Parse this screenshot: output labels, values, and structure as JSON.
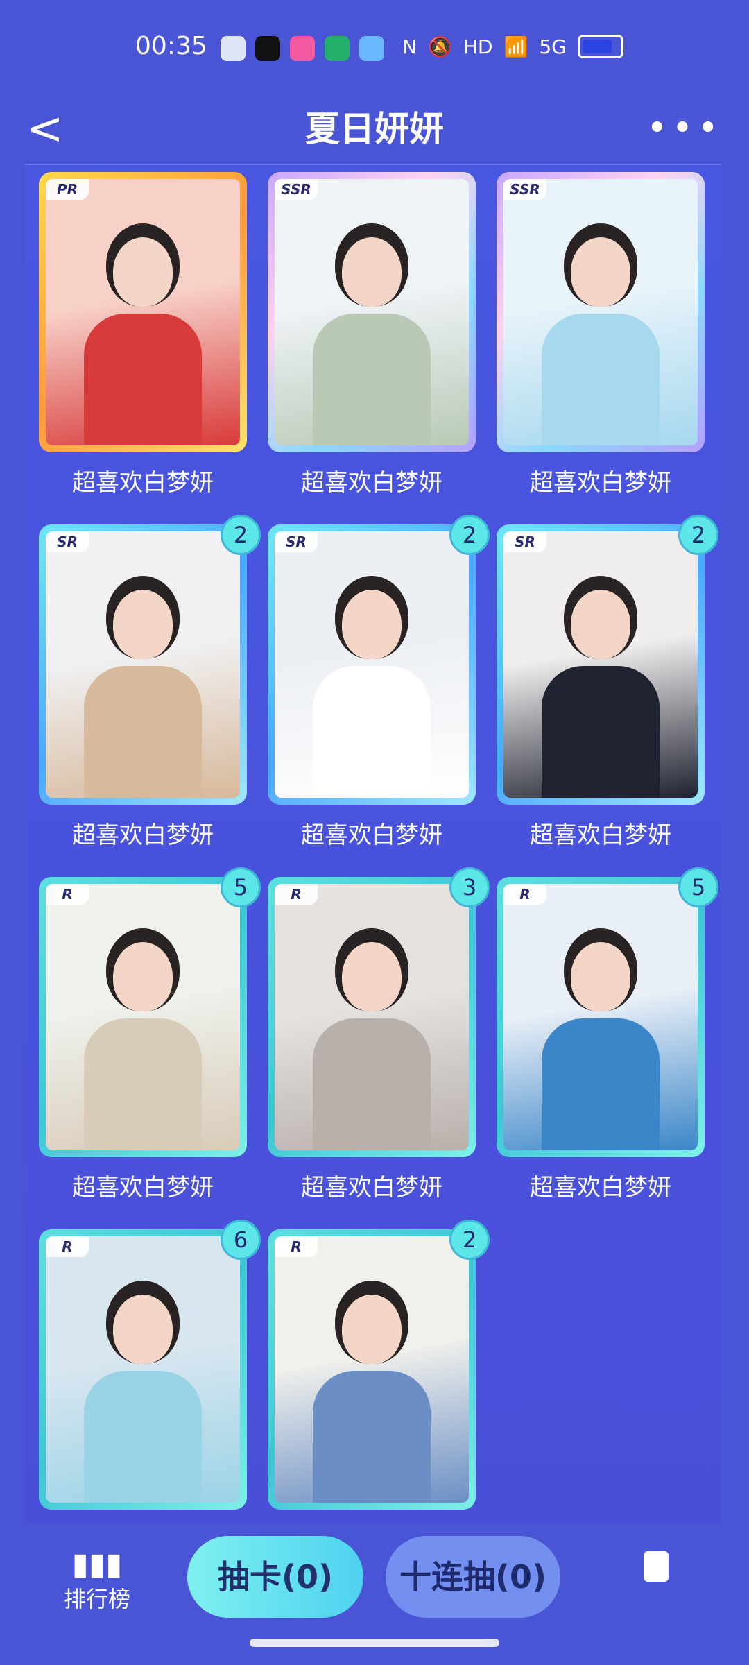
{
  "status": {
    "time": "00:35",
    "network": "5G",
    "hd": "HD"
  },
  "nav": {
    "back": "<",
    "title": "夏日妍妍",
    "more": "•••"
  },
  "cards": [
    {
      "rarity": "PR",
      "count": "",
      "label": "超喜欢白梦妍",
      "style": "pr",
      "top": "#f7d0c8",
      "bottom": "#d83a3a"
    },
    {
      "rarity": "SSR",
      "count": "",
      "label": "超喜欢白梦妍",
      "style": "ssr",
      "top": "#eef3f6",
      "bottom": "#b9c9b6"
    },
    {
      "rarity": "SSR",
      "count": "",
      "label": "超喜欢白梦妍",
      "style": "ssr",
      "top": "#e8f3fa",
      "bottom": "#a6d8ee"
    },
    {
      "rarity": "SR",
      "count": "2",
      "label": "超喜欢白梦妍",
      "style": "sr",
      "top": "#f1f1f3",
      "bottom": "#d7b99b"
    },
    {
      "rarity": "SR",
      "count": "2",
      "label": "超喜欢白梦妍",
      "style": "sr",
      "top": "#eceff4",
      "bottom": "#ffffff"
    },
    {
      "rarity": "SR",
      "count": "2",
      "label": "超喜欢白梦妍",
      "style": "sr",
      "top": "#f0eded",
      "bottom": "#1f2230"
    },
    {
      "rarity": "R",
      "count": "5",
      "label": "超喜欢白梦妍",
      "style": "r",
      "top": "#eef1ec",
      "bottom": "#d9cbb9"
    },
    {
      "rarity": "R",
      "count": "3",
      "label": "超喜欢白梦妍",
      "style": "r",
      "top": "#e6e2e0",
      "bottom": "#b8b0ab"
    },
    {
      "rarity": "R",
      "count": "5",
      "label": "超喜欢白梦妍",
      "style": "r",
      "top": "#eaf0f7",
      "bottom": "#3b86c8"
    },
    {
      "rarity": "R",
      "count": "6",
      "label": "",
      "style": "r",
      "top": "#d8e6f0",
      "bottom": "#9bd3e6"
    },
    {
      "rarity": "R",
      "count": "2",
      "label": "",
      "style": "r",
      "top": "#f0f0ec",
      "bottom": "#6b8fc4"
    }
  ],
  "bottom": {
    "rank_label": "排行榜",
    "draw_label": "抽卡(0)",
    "ten_draw_label": "十连抽(0)"
  }
}
